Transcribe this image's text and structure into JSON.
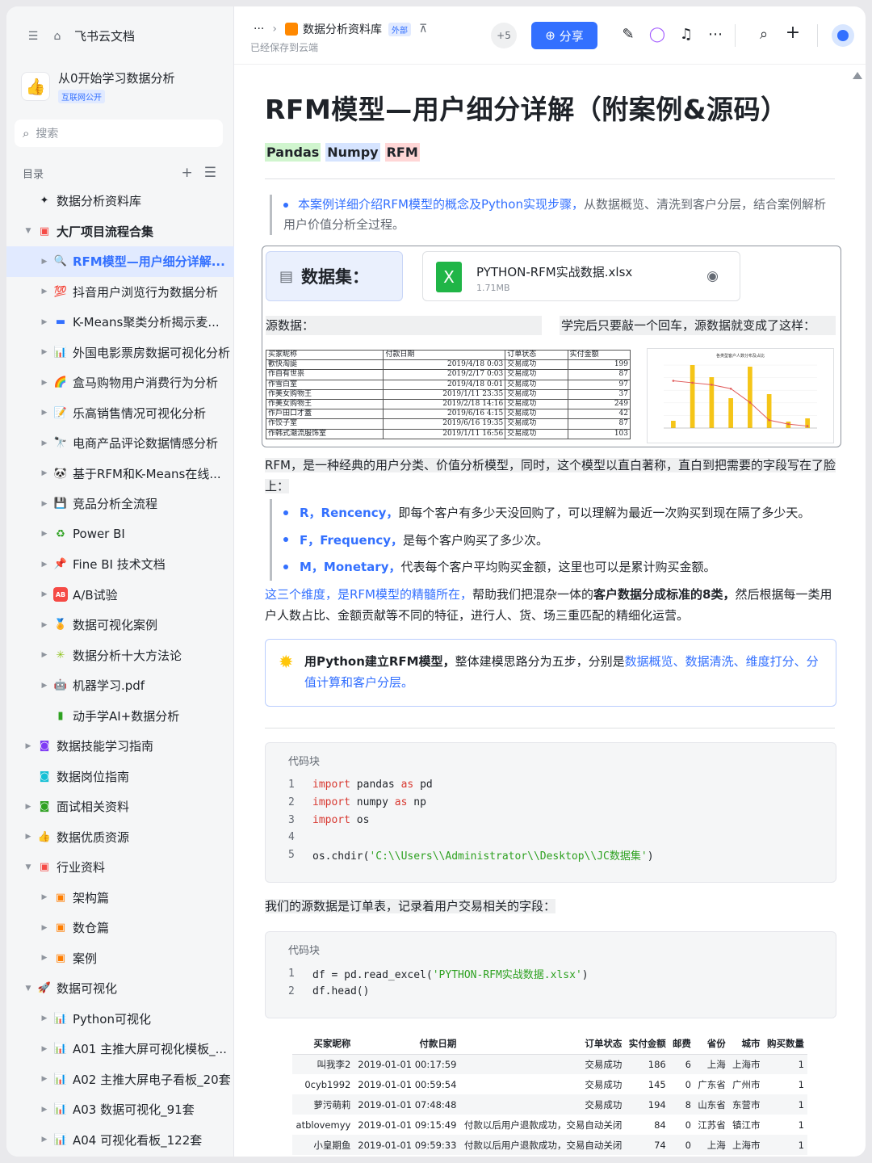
{
  "sidebar": {
    "home_label": "飞书云文档",
    "space_name": "从0开始学习数据分析",
    "space_badge": "互联网公开",
    "search_placeholder": "搜索",
    "toc_label": "目录",
    "tree": [
      {
        "label": "数据分析资料库",
        "icon": "sparkle-icon",
        "icon_char": "✦",
        "icon_color": "#1f2329",
        "level": 0,
        "arrow": "",
        "bold": false
      },
      {
        "label": "大厂项目流程合集",
        "icon": "doc-icon",
        "icon_char": "▣",
        "icon_color": "#f54a45",
        "level": 0,
        "arrow": "▼",
        "bold": true
      },
      {
        "label": "RFM模型—用户细分详解...",
        "icon": "magnifier-icon",
        "icon_char": "🔍",
        "icon_color": "#3370ff",
        "level": 1,
        "arrow": "▶",
        "active": true
      },
      {
        "label": "抖音用户浏览行为数据分析",
        "icon": "hundred-icon",
        "icon_char": "💯",
        "icon_color": "#f54a45",
        "level": 1,
        "arrow": "▶"
      },
      {
        "label": "K-Means聚类分析揭示麦...",
        "icon": "monitor-icon",
        "icon_char": "▬",
        "icon_color": "#3370ff",
        "level": 1,
        "arrow": "▶"
      },
      {
        "label": "外国电影票房数据可视化分析",
        "icon": "barchart-icon",
        "icon_char": "📊",
        "icon_color": "#3370ff",
        "level": 1,
        "arrow": "▶"
      },
      {
        "label": "盒马购物用户消费行为分析",
        "icon": "rainbow-icon",
        "icon_char": "🌈",
        "icon_color": "#ff8800",
        "level": 1,
        "arrow": "▶"
      },
      {
        "label": "乐高销售情况可视化分析",
        "icon": "memo-icon",
        "icon_char": "📝",
        "icon_color": "#f54a45",
        "level": 1,
        "arrow": "▶"
      },
      {
        "label": "电商产品评论数据情感分析",
        "icon": "telescope-icon",
        "icon_char": "🔭",
        "icon_color": "#3370ff",
        "level": 1,
        "arrow": "▶"
      },
      {
        "label": "基于RFM和K-Means在线...",
        "icon": "panda-icon",
        "icon_char": "🐼",
        "icon_color": "#1f2329",
        "level": 1,
        "arrow": "▶"
      },
      {
        "label": "竞品分析全流程",
        "icon": "floppy-icon",
        "icon_char": "💾",
        "icon_color": "#7f3bf5",
        "level": 1,
        "arrow": "▶"
      },
      {
        "label": "Power BI",
        "icon": "recycle-icon",
        "icon_char": "♻",
        "icon_color": "#2ea121",
        "level": 1,
        "arrow": "▶"
      },
      {
        "label": "Fine BI 技术文档",
        "icon": "pushpin-icon",
        "icon_char": "📌",
        "icon_color": "#f54a45",
        "level": 1,
        "arrow": "▶"
      },
      {
        "label": "A/B试验",
        "icon": "ab-icon",
        "icon_char": "AB",
        "icon_color": "#f54a45",
        "level": 1,
        "arrow": "▶"
      },
      {
        "label": "数据可视化案例",
        "icon": "medal-icon",
        "icon_char": "🏅",
        "icon_color": "#ff8800",
        "level": 1,
        "arrow": "▶"
      },
      {
        "label": "数据分析十大方法论",
        "icon": "burst-icon",
        "icon_char": "✳",
        "icon_color": "#8fc31f",
        "level": 1,
        "arrow": "▶"
      },
      {
        "label": "机器学习.pdf",
        "icon": "robot-icon",
        "icon_char": "🤖",
        "icon_color": "#646a73",
        "level": 1,
        "arrow": "▶"
      },
      {
        "label": "动手学AI+数据分析",
        "icon": "battery-icon",
        "icon_char": "▮",
        "icon_color": "#2ea121",
        "level": 1,
        "arrow": ""
      },
      {
        "label": "数据技能学习指南",
        "icon": "book-purple-icon",
        "icon_char": "◙",
        "icon_color": "#7f3bf5",
        "level": 0,
        "arrow": "▶"
      },
      {
        "label": "数据岗位指南",
        "icon": "book-teal-icon",
        "icon_char": "◙",
        "icon_color": "#14c0d5",
        "level": 0,
        "arrow": ""
      },
      {
        "label": "面试相关资料",
        "icon": "book-green-icon",
        "icon_char": "◙",
        "icon_color": "#2ea121",
        "level": 0,
        "arrow": "▶"
      },
      {
        "label": "数据优质资源",
        "icon": "thumbsup-icon",
        "icon_char": "👍",
        "icon_color": "#ff8800",
        "level": 0,
        "arrow": "▶"
      },
      {
        "label": "行业资料",
        "icon": "book-pink-icon",
        "icon_char": "▣",
        "icon_color": "#f54a45",
        "level": 0,
        "arrow": "▼"
      },
      {
        "label": "架构篇",
        "icon": "orange-doc-icon",
        "icon_char": "▣",
        "icon_color": "#ff7d00",
        "level": 1,
        "arrow": "▶"
      },
      {
        "label": "数仓篇",
        "icon": "orange-doc-icon",
        "icon_char": "▣",
        "icon_color": "#ff7d00",
        "level": 1,
        "arrow": "▶"
      },
      {
        "label": "案例",
        "icon": "orange-doc-icon",
        "icon_char": "▣",
        "icon_color": "#ff7d00",
        "level": 1,
        "arrow": "▶"
      },
      {
        "label": "数据可视化",
        "icon": "rocket-icon",
        "icon_char": "🚀",
        "icon_color": "#f54a45",
        "level": 0,
        "arrow": "▼"
      },
      {
        "label": "Python可视化",
        "icon": "barchart-icon",
        "icon_char": "📊",
        "icon_color": "#3370ff",
        "level": 1,
        "arrow": "▶"
      },
      {
        "label": "A01 主推大屏可视化模板_...",
        "icon": "barchart-icon",
        "icon_char": "📊",
        "icon_color": "#3370ff",
        "level": 1,
        "arrow": "▶"
      },
      {
        "label": "A02 主推大屏电子看板_20套",
        "icon": "barchart-icon",
        "icon_char": "📊",
        "icon_color": "#3370ff",
        "level": 1,
        "arrow": "▶"
      },
      {
        "label": "A03 数据可视化_91套",
        "icon": "barchart-icon",
        "icon_char": "📊",
        "icon_color": "#3370ff",
        "level": 1,
        "arrow": "▶"
      },
      {
        "label": "A04 可视化看板_122套",
        "icon": "barchart-icon",
        "icon_char": "📊",
        "icon_color": "#3370ff",
        "level": 1,
        "arrow": "▶"
      }
    ]
  },
  "header": {
    "breadcrumb_more": "···",
    "doc_lib": "数据分析资料库",
    "ext_badge": "外部",
    "saved_text": "已经保存到云端",
    "collaborators": "+5",
    "share_label": "分享"
  },
  "doc": {
    "title": "RFM模型—用户细分详解（附案例&源码）",
    "tags": [
      "Pandas",
      "Numpy",
      "RFM"
    ],
    "intro_blue": "本案例详细介绍RFM模型的概念及Python实现步骤，",
    "intro_rest": "从数据概览、清洗到客户分层，结合案例解析用户价值分析全过程。",
    "dataset_label": "数据集：",
    "file_name": "PYTHON-RFM实战数据.xlsx",
    "file_size": "1.71MB",
    "file_icon_letter": "X",
    "source_label": "源数据：",
    "after_label": "学完后只要敲一个回车，源数据就变成了这样：",
    "mini_table": {
      "headers": [
        "买家昵称",
        "付款日期",
        "订单状态",
        "实付金额"
      ],
      "rows": [
        [
          "歡快淘誕",
          "2019/4/18  0:03",
          "交易成功",
          "199"
        ],
        [
          "作自有世祟",
          "2019/2/17  0:03",
          "交易成功",
          "87"
        ],
        [
          "作雪白室",
          "2019/4/18  0:01",
          "交易成功",
          "97"
        ],
        [
          "作美女购物王",
          "2019/1/11  23:35",
          "交易成功",
          "37"
        ],
        [
          "作美女购物王",
          "2019/2/18  14:16",
          "交易成功",
          "249"
        ],
        [
          "作戶田口才蓋",
          "2019/6/16  4:15",
          "交易成功",
          "42"
        ],
        [
          "作饺子室",
          "2019/6/16  19:35",
          "交易成功",
          "87"
        ],
        [
          "作韩式潮流服饰室",
          "2019/1/11  16:56",
          "交易成功",
          "103"
        ]
      ]
    },
    "mini_chart_title": "各类型客户人数分布及占比",
    "rfm_intro": "RFM，是一种经典的用户分类、价值分析模型，同时，这个模型以直白著称，直白到把需要的字段写在了脸上：",
    "rfm_items": [
      {
        "key": "R，Rencency，",
        "text": "即每个客户有多少天没回购了，可以理解为最近一次购买到现在隔了多少天。"
      },
      {
        "key": "F，Frequency，",
        "text": "是每个客户购买了多少次。"
      },
      {
        "key": "M，Monetary，",
        "text": "代表每个客户平均购买金额，这里也可以是累计购买金额。"
      }
    ],
    "dims_blue": "这三个维度，是RFM模型的精髓所在，",
    "dims_mid": "帮助我们把混杂一体的",
    "dims_bold": "客户数据分成标准的8类，",
    "dims_rest": "然后根据每一类用户人数占比、金额贡献等不同的特征，进行人、货、场三重匹配的精细化运营。",
    "callout_bold": "用Python建立RFM模型，",
    "callout_mid": "整体建模思路分为五步，分别是",
    "callout_blue": "数据概览、数据清洗、维度打分、分值计算和客户分层。",
    "code_header": "代码块",
    "code1": [
      {
        "n": "1",
        "kw": "import",
        "a": " pandas ",
        "kw2": "as",
        "b": " pd",
        "s": ""
      },
      {
        "n": "2",
        "kw": "import",
        "a": " numpy ",
        "kw2": "as",
        "b": " np",
        "s": ""
      },
      {
        "n": "3",
        "kw": "import",
        "a": " os",
        "kw2": "",
        "b": "",
        "s": ""
      },
      {
        "n": "4",
        "kw": "",
        "a": "",
        "kw2": "",
        "b": "",
        "s": ""
      },
      {
        "n": "5",
        "kw": "",
        "a": "os.chdir(",
        "kw2": "",
        "b": ")",
        "s": "'C:\\\\Users\\\\Administrator\\\\Desktop\\\\JC数据集'"
      }
    ],
    "order_note": "我们的源数据是订单表，记录着用户交易相关的字段：",
    "code2": [
      {
        "n": "1",
        "a": "df = pd.read_excel(",
        "s": "'PYTHON-RFM实战数据.xlsx'",
        "b": ")"
      },
      {
        "n": "2",
        "a": "df.head()",
        "s": "",
        "b": ""
      }
    ],
    "df_headers": [
      "买家昵称",
      "付款日期",
      "订单状态",
      "实付金额",
      "邮费",
      "省份",
      "城市",
      "购买数量"
    ],
    "df_rows": [
      [
        "叫我李2",
        "2019-01-01 00:17:59",
        "交易成功",
        "186",
        "6",
        "上海",
        "上海市",
        "1"
      ],
      [
        "0cyb1992",
        "2019-01-01 00:59:54",
        "交易成功",
        "145",
        "0",
        "广东省",
        "广州市",
        "1"
      ],
      [
        "萝污萌莉",
        "2019-01-01 07:48:48",
        "交易成功",
        "194",
        "8",
        "山东省",
        "东营市",
        "1"
      ],
      [
        "atblovemyy",
        "2019-01-01 09:15:49",
        "付款以后用户退款成功，交易自动关闭",
        "84",
        "0",
        "江苏省",
        "镇江市",
        "1"
      ],
      [
        "小皇期鱼",
        "2019-01-01 09:59:33",
        "付款以后用户退款成功，交易自动关闭",
        "74",
        "0",
        "上海",
        "上海市",
        "1"
      ]
    ]
  },
  "chart_data": {
    "type": "bar",
    "title": "各类型客户人数分布及占比",
    "categories": [
      "c1",
      "c2",
      "c3",
      "c4",
      "c5",
      "c6",
      "c7",
      "c8"
    ],
    "series": [
      {
        "name": "人数",
        "values": [
          9,
          78,
          63,
          37,
          76,
          42,
          8,
          12
        ]
      },
      {
        "name": "占比",
        "values": [
          24,
          23,
          22,
          20,
          13,
          4,
          2,
          1
        ]
      }
    ],
    "colors": {
      "bar": "#f5c518",
      "line": "#e05a5a"
    }
  },
  "colors": {
    "accent": "#3370ff",
    "code_keyword": "#d83931",
    "code_string": "#2ea121"
  }
}
